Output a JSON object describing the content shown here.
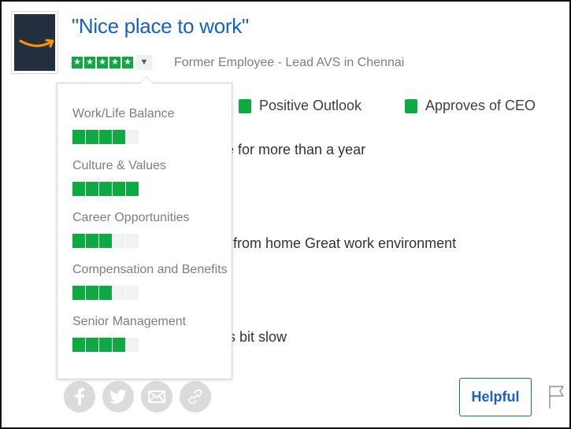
{
  "review": {
    "title": "\"Nice place to work\"",
    "overall_rating": 5,
    "employee": "Former Employee - Lead AVS in Chennai"
  },
  "flags": [
    {
      "label": "Positive Outlook",
      "color": "#0caa41"
    },
    {
      "label": "Approves of CEO",
      "color": "#0caa41"
    }
  ],
  "body": {
    "tenure": "e for more than a year",
    "pros": "from home Great work environment",
    "cons": "s bit slow"
  },
  "subratings": [
    {
      "label": "Work/Life Balance",
      "rating": 4
    },
    {
      "label": "Culture & Values",
      "rating": 5
    },
    {
      "label": "Career Opportunities",
      "rating": 3
    },
    {
      "label": "Compensation and Benefits",
      "rating": 3
    },
    {
      "label": "Senior Management",
      "rating": 4
    }
  ],
  "actions": {
    "helpful_label": "Helpful",
    "share_icons": [
      "facebook-icon",
      "twitter-icon",
      "email-icon",
      "link-icon"
    ]
  },
  "colors": {
    "title": "#1861bf",
    "rating_green": "#0caa41",
    "logo_bg": "#232f3e",
    "logo_smile": "#f79400"
  }
}
